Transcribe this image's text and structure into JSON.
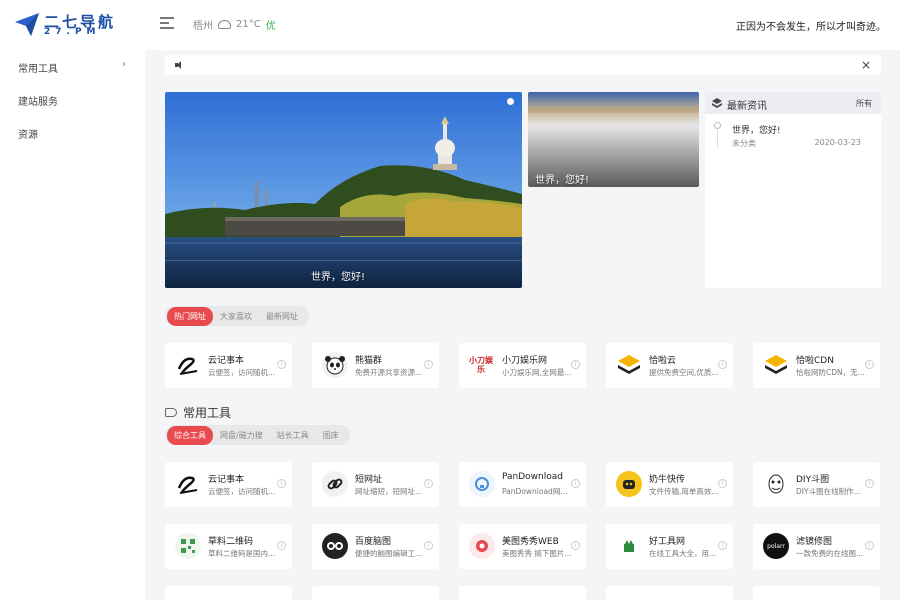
{
  "header": {
    "logo_title": "二七导航",
    "logo_sub": "27.PM",
    "weather_city": "梧州",
    "weather_temp": "21°C",
    "weather_quality": "优",
    "motto": "正因为不会发生，所以才叫奇迹。"
  },
  "sidebar": {
    "items": [
      {
        "label": "常用工具",
        "arrow": "›"
      },
      {
        "label": "建站服务"
      },
      {
        "label": "资源"
      }
    ]
  },
  "notice": {
    "close": "×"
  },
  "banner": {
    "main_caption": "世界，您好!",
    "side_caption": "世界，您好!"
  },
  "news": {
    "title": "最新资讯",
    "all_label": "所有",
    "items": [
      {
        "title": "世界，您好!",
        "category": "未分类",
        "date": "2020-03-23"
      }
    ]
  },
  "hot_tabs": [
    "热门网址",
    "大家喜欢",
    "最新网址"
  ],
  "hot_cards": [
    {
      "name": "云记事本",
      "desc": "云便签，访问随机...",
      "icon": "cloud-note-icon"
    },
    {
      "name": "熊猫群",
      "desc": "免费开源共享资源...",
      "icon": "panda-icon"
    },
    {
      "name": "小刀娱乐网",
      "desc": "小刀娱乐网,全网最...",
      "icon": "xiaodao-icon",
      "icon_text": "小刀娱乐"
    },
    {
      "name": "恰啦云",
      "desc": "提供免费空间,优质...",
      "icon": "layers-icon"
    },
    {
      "name": "恰啦CDN",
      "desc": "恰啦网防CDN，无...",
      "icon": "layers-icon"
    }
  ],
  "tools_section": {
    "title": "常用工具"
  },
  "tool_tabs": [
    "综合工具",
    "网盘/磁力搜",
    "站长工具",
    "图床"
  ],
  "tool_cards": [
    {
      "name": "云记事本",
      "desc": "云便签，访问随机...",
      "icon": "cloud-note-icon"
    },
    {
      "name": "短网址",
      "desc": "网址缩短，短网址...",
      "icon": "link-icon"
    },
    {
      "name": "PanDownload",
      "desc": "PanDownload网...",
      "icon": "pandownload-icon"
    },
    {
      "name": "奶牛快传",
      "desc": "文件传输,简单高效...",
      "icon": "cow-icon"
    },
    {
      "name": "DIY斗图",
      "desc": "DIY斗图在线制作...",
      "icon": "doutu-icon"
    },
    {
      "name": "草料二维码",
      "desc": "草料二维码是国内...",
      "icon": "qrcode-icon"
    },
    {
      "name": "百度脑图",
      "desc": "便捷的脑图编辑工...",
      "icon": "mindmap-icon"
    },
    {
      "name": "美图秀秀WEB",
      "desc": "美图秀秀 搞下图片...",
      "icon": "meitu-icon"
    },
    {
      "name": "好工具网",
      "desc": "在线工具大全，用...",
      "icon": "tools-icon"
    },
    {
      "name": "滤镜修图",
      "desc": "一款免费的在线图...",
      "icon": "polarr-icon",
      "icon_text": "polarr"
    }
  ],
  "colors": {
    "accent": "#e94a4f",
    "brand": "#1d4fa3",
    "quality_good": "#3bb34a"
  }
}
